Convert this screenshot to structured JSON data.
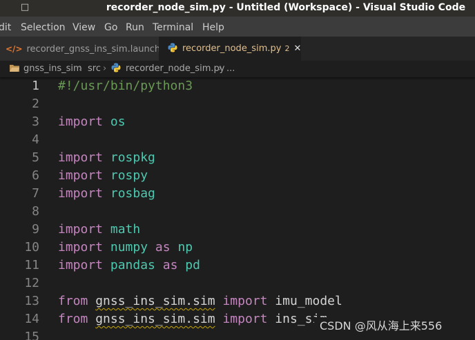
{
  "window": {
    "title": "recorder_node_sim.py - Untitled (Workspace) - Visual Studio Code"
  },
  "menu": [
    "dit",
    "Selection",
    "View",
    "Go",
    "Run",
    "Terminal",
    "Help"
  ],
  "tabs": [
    {
      "label": "recorder_gnss_ins_sim.launch",
      "icon": "xml-icon",
      "active": false
    },
    {
      "label": "recorder_node_sim.py",
      "icon": "python-icon",
      "active": true,
      "badge": "2",
      "close": "✕"
    }
  ],
  "breadcrumb": [
    "gnss_ins_sim",
    "src",
    "recorder_node_sim.py",
    "..."
  ],
  "editor": {
    "active_line": 1,
    "lines": [
      {
        "n": "1",
        "tokens": [
          {
            "t": "#!/usr/bin/python3",
            "c": "comment"
          }
        ]
      },
      {
        "n": "2",
        "tokens": []
      },
      {
        "n": "3",
        "tokens": [
          {
            "t": "import",
            "c": "kw"
          },
          {
            "t": " ",
            "c": "id"
          },
          {
            "t": "os",
            "c": "mod"
          }
        ]
      },
      {
        "n": "4",
        "tokens": []
      },
      {
        "n": "5",
        "tokens": [
          {
            "t": "import",
            "c": "kw"
          },
          {
            "t": " ",
            "c": "id"
          },
          {
            "t": "rospkg",
            "c": "mod"
          }
        ]
      },
      {
        "n": "6",
        "tokens": [
          {
            "t": "import",
            "c": "kw"
          },
          {
            "t": " ",
            "c": "id"
          },
          {
            "t": "rospy",
            "c": "mod"
          }
        ]
      },
      {
        "n": "7",
        "tokens": [
          {
            "t": "import",
            "c": "kw"
          },
          {
            "t": " ",
            "c": "id"
          },
          {
            "t": "rosbag",
            "c": "mod"
          }
        ]
      },
      {
        "n": "8",
        "tokens": []
      },
      {
        "n": "9",
        "tokens": [
          {
            "t": "import",
            "c": "kw"
          },
          {
            "t": " ",
            "c": "id"
          },
          {
            "t": "math",
            "c": "mod"
          }
        ]
      },
      {
        "n": "10",
        "tokens": [
          {
            "t": "import",
            "c": "kw"
          },
          {
            "t": " ",
            "c": "id"
          },
          {
            "t": "numpy",
            "c": "mod"
          },
          {
            "t": " ",
            "c": "id"
          },
          {
            "t": "as",
            "c": "kw"
          },
          {
            "t": " ",
            "c": "id"
          },
          {
            "t": "np",
            "c": "mod"
          }
        ]
      },
      {
        "n": "11",
        "tokens": [
          {
            "t": "import",
            "c": "kw"
          },
          {
            "t": " ",
            "c": "id"
          },
          {
            "t": "pandas",
            "c": "mod"
          },
          {
            "t": " ",
            "c": "id"
          },
          {
            "t": "as",
            "c": "kw"
          },
          {
            "t": " ",
            "c": "id"
          },
          {
            "t": "pd",
            "c": "mod"
          }
        ]
      },
      {
        "n": "12",
        "tokens": []
      },
      {
        "n": "13",
        "tokens": [
          {
            "t": "from",
            "c": "kw"
          },
          {
            "t": " ",
            "c": "id"
          },
          {
            "t": "gnss_ins_sim.sim",
            "c": "squig"
          },
          {
            "t": " ",
            "c": "id"
          },
          {
            "t": "import",
            "c": "kw"
          },
          {
            "t": " imu_model",
            "c": "id"
          }
        ]
      },
      {
        "n": "14",
        "tokens": [
          {
            "t": "from",
            "c": "kw"
          },
          {
            "t": " ",
            "c": "id"
          },
          {
            "t": "gnss_ins_sim.sim",
            "c": "squig"
          },
          {
            "t": " ",
            "c": "id"
          },
          {
            "t": "import",
            "c": "kw"
          },
          {
            "t": " ins_sim",
            "c": "id"
          }
        ]
      },
      {
        "n": "15",
        "tokens": []
      }
    ]
  },
  "watermark": "CSDN @风从海上来556",
  "colors": {
    "titlebar_bg": "#2f2e2b",
    "menubar_bg": "#3c3c3c",
    "editor_bg": "#1e1e1e",
    "keyword": "#c586c0",
    "module": "#4ec9b0",
    "comment": "#6a9955",
    "identifier": "#d4d4d4",
    "modified_tab": "#e2c08d"
  }
}
